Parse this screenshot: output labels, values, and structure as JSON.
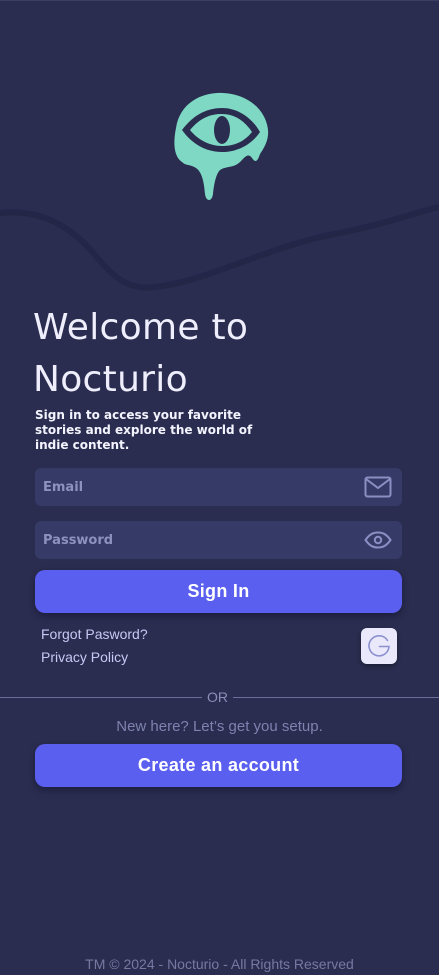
{
  "app": {
    "name": "Nocturio"
  },
  "logo": {
    "icon": "drip-eye-logo",
    "color": "#7fd8c4"
  },
  "header": {
    "title": "Welcome to Nocturio",
    "subtitle": "Sign in to access your favorite stories and explore the world of indie content."
  },
  "form": {
    "email": {
      "placeholder": "Email",
      "value": "",
      "icon": "mail-icon"
    },
    "password": {
      "placeholder": "Password",
      "value": "",
      "icon": "eye-icon"
    },
    "signin_label": "Sign In"
  },
  "links": {
    "forgot_password": "Forgot Pasword?",
    "privacy_policy": "Privacy Policy"
  },
  "social": {
    "google_icon": "google-icon"
  },
  "divider": {
    "label": "OR"
  },
  "signup": {
    "prompt": "New here? Let’s get you setup.",
    "create_label": "Create an account"
  },
  "footer": {
    "text": "TM © 2024 - Nocturio - All Rights Reserved"
  },
  "colors": {
    "background": "#2a2d4f",
    "accent": "#5a5fef",
    "field_bg": "#353a66",
    "logo": "#7fd8c4"
  }
}
